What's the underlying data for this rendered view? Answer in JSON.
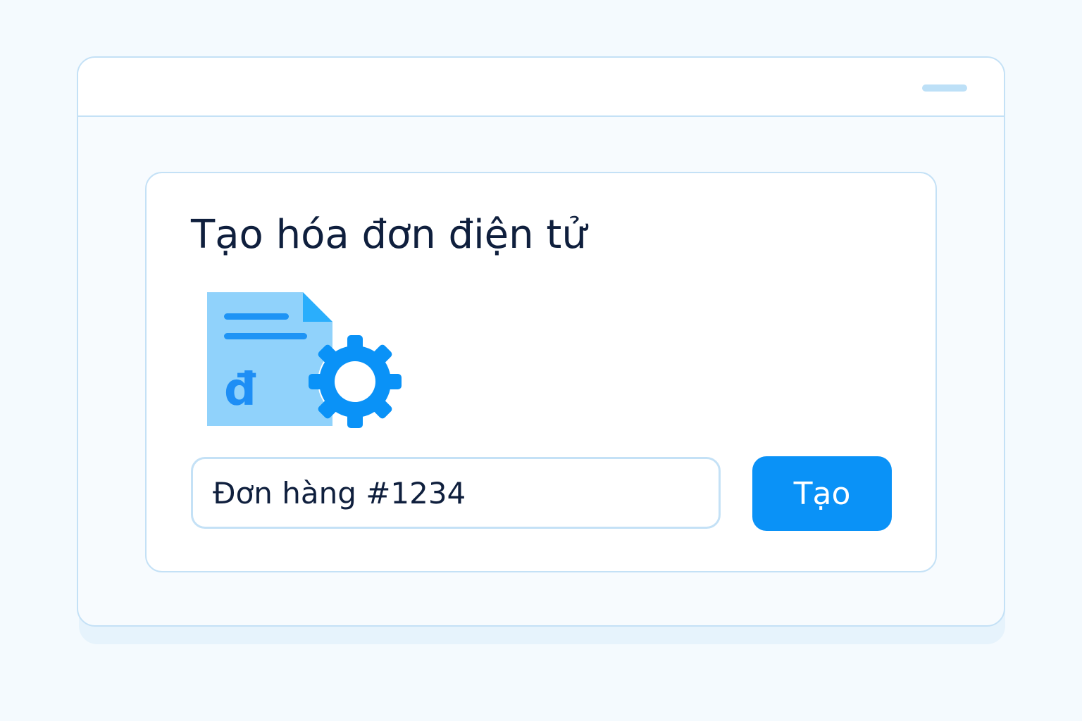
{
  "invoice_form": {
    "title": "Tạo hóa đơn điện tử",
    "order_input_value": "Đơn hàng #1234",
    "create_button_label": "Tạo",
    "illustration": {
      "icons": [
        "invoice-document-icon",
        "gear-icon"
      ],
      "currency_symbol": "đ"
    }
  },
  "colors": {
    "accent": "#0a92f7",
    "document_fill": "#90d2fb",
    "document_fold": "#2aaefc",
    "border": "#c4e1f6",
    "text_primary": "#0f1f3d"
  }
}
